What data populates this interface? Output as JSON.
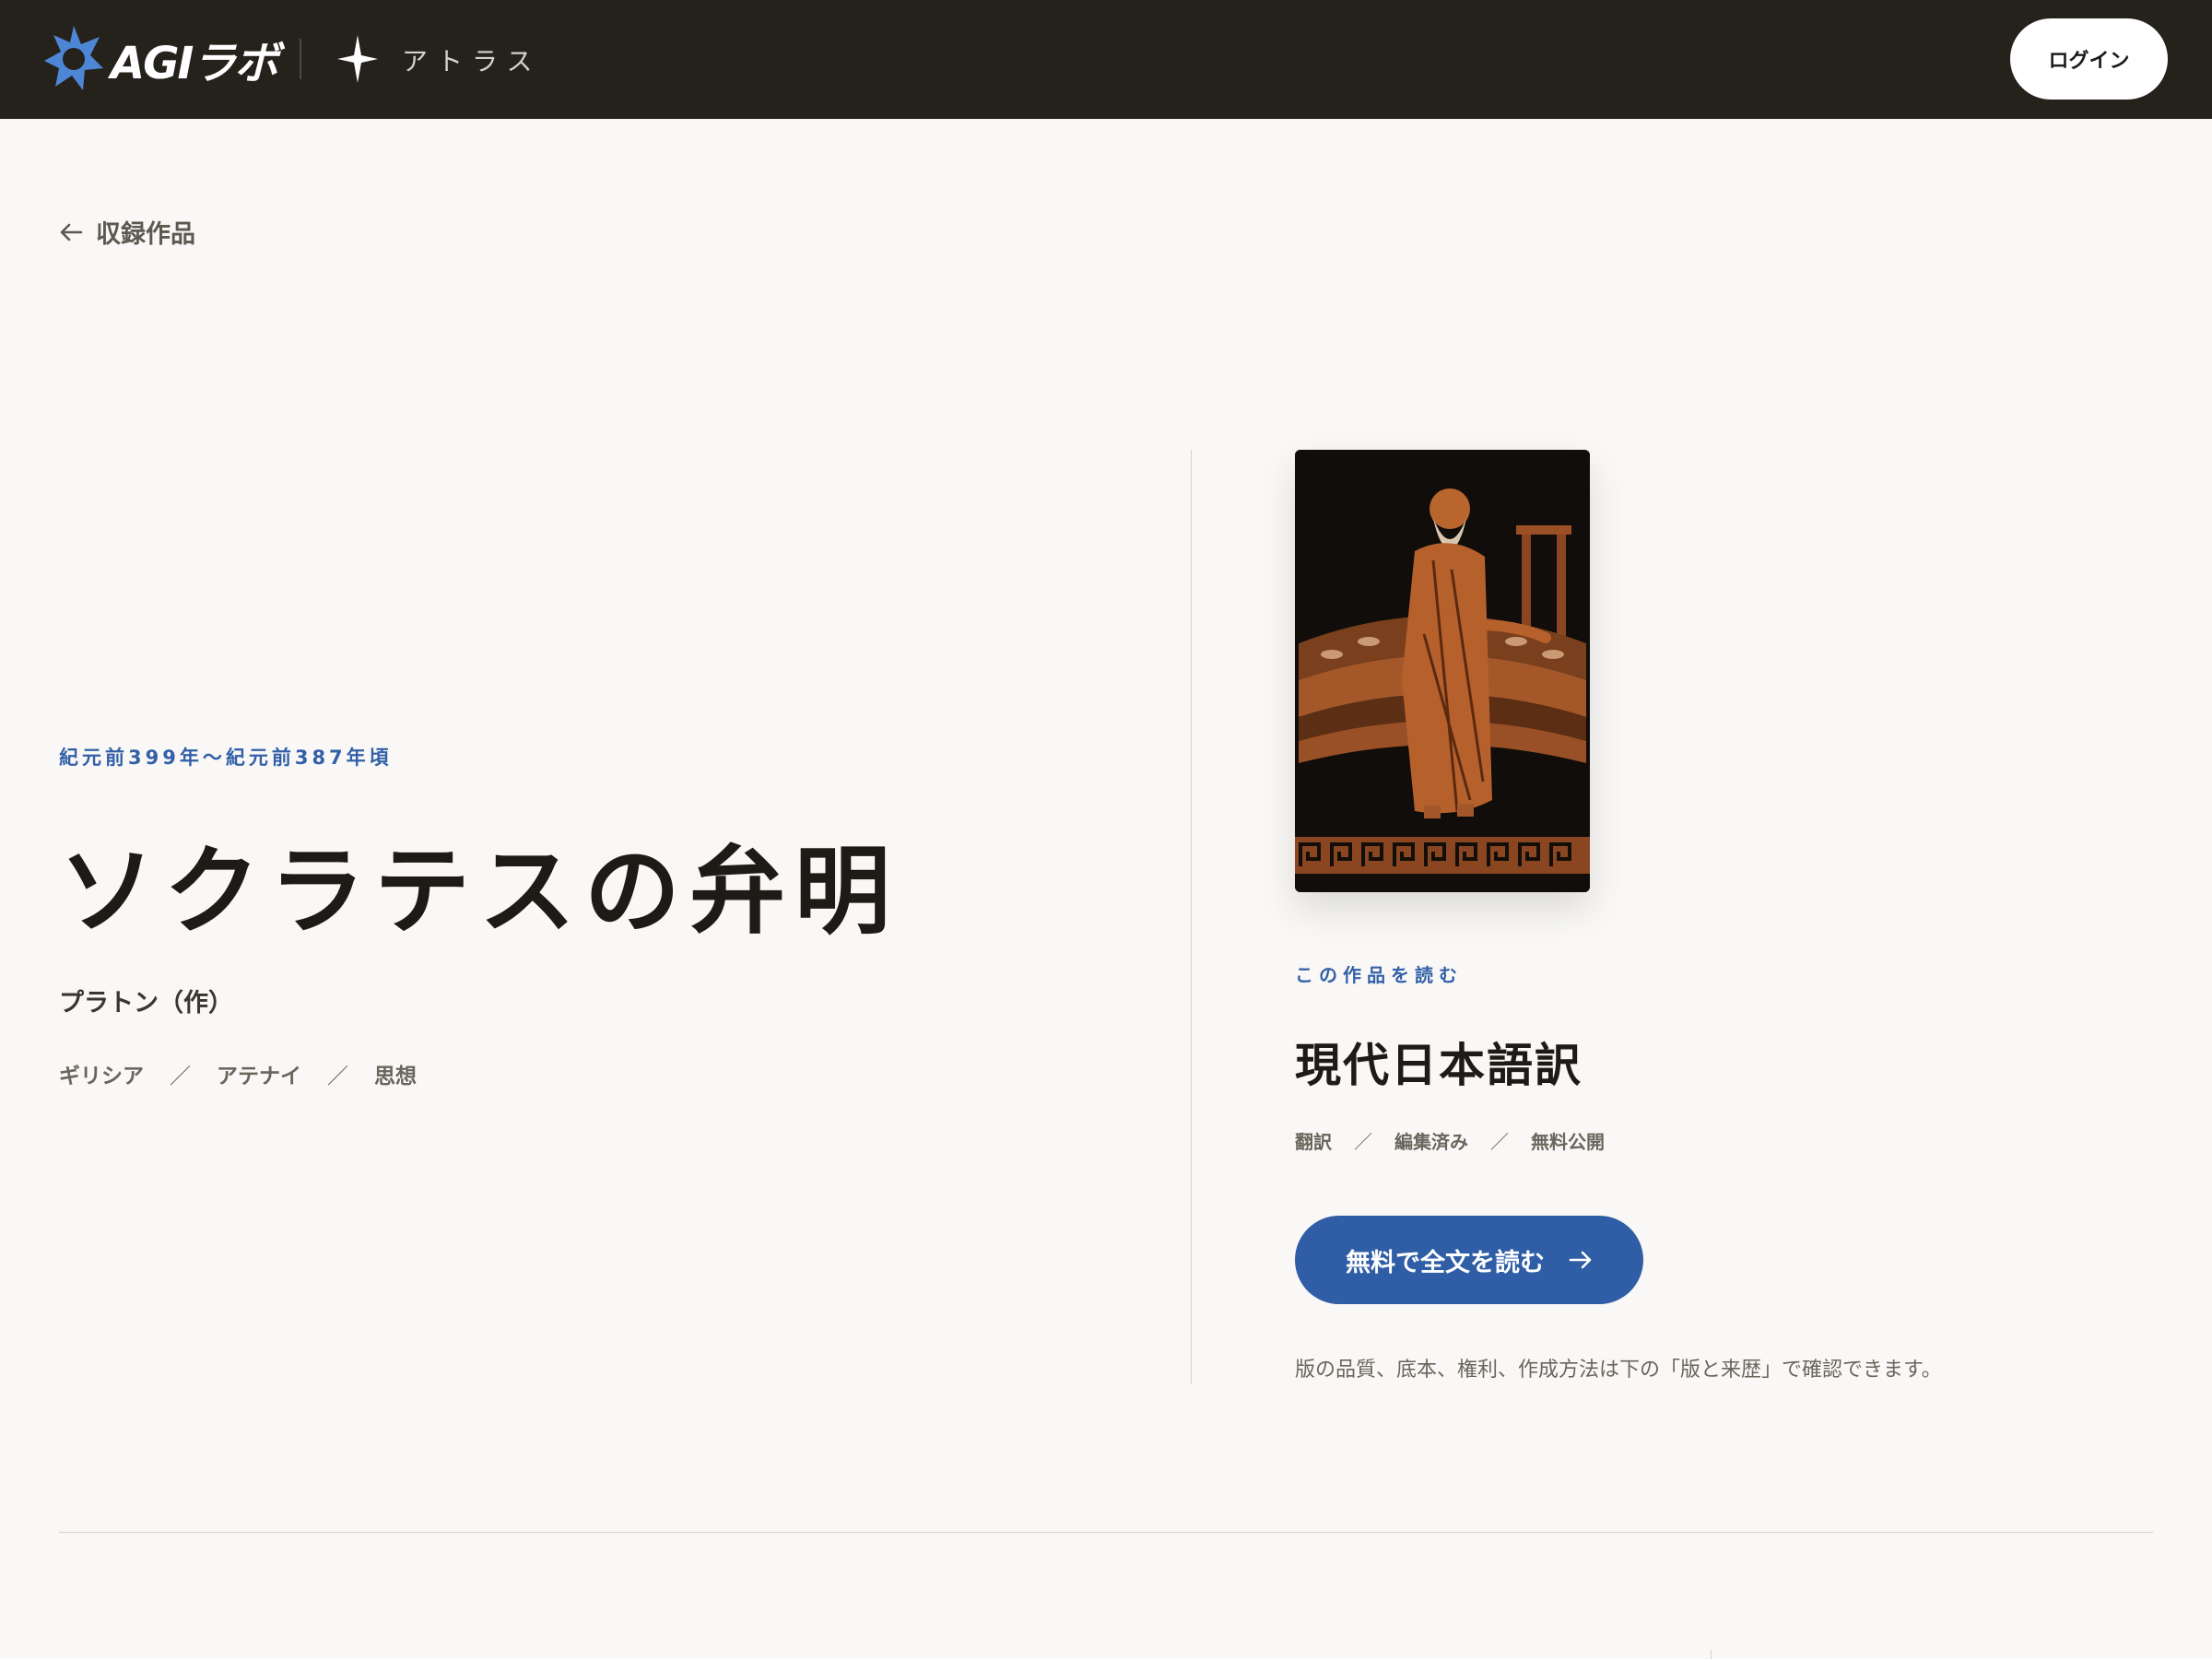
{
  "header": {
    "brand": "AGIラボ",
    "product": "アトラス",
    "login_label": "ログイン",
    "brand_color": "#4e86d6",
    "bar_color": "#25211b"
  },
  "nav": {
    "back_label": "収録作品"
  },
  "work": {
    "era": "紀元前399年〜紀元前387年頃",
    "title": "ソクラテスの弁明",
    "author": "プラトン（作）",
    "tags": [
      "ギリシア",
      "アテナイ",
      "思想"
    ]
  },
  "edition": {
    "kicker": "この作品を読む",
    "title": "現代日本語訳",
    "tags": [
      "翻訳",
      "編集済み",
      "無料公開"
    ],
    "read_label": "無料で全文を読む",
    "note": "版の品質、底本、権利、作成方法は下の「版と来歴」で確認できます。",
    "accent_color": "#2f5ea6"
  },
  "icons": {
    "logo": "agi-lab-logo-icon",
    "atlas": "four-point-star-icon",
    "back": "arrow-left-icon",
    "forward": "arrow-right-icon"
  }
}
